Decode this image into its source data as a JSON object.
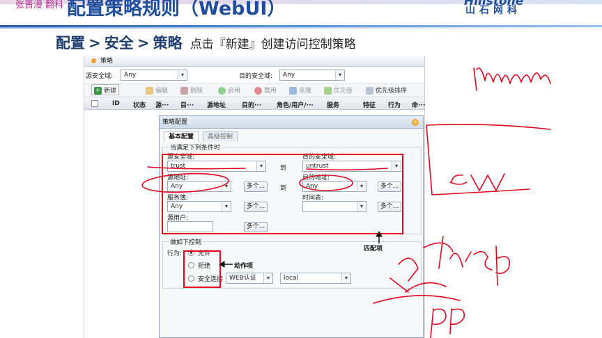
{
  "slide": {
    "title": "配置策略规则（WebUI）",
    "corner_tag": "张晋漫 翻科",
    "logo_en": "Hillstone",
    "logo_cn": "山石网科",
    "breadcrumb": {
      "part1": "配置",
      "sep1": ">",
      "part2": "安全",
      "sep2": ">",
      "part3": "策略",
      "instruction": "点击『新建』创建访问控制策略"
    }
  },
  "panel": {
    "title": "策略",
    "filter": {
      "src_zone_label": "源安全域:",
      "src_zone_value": "Any",
      "dst_zone_label": "目的安全域:",
      "dst_zone_value": "Any"
    },
    "toolbar": {
      "new": "新建",
      "edit": "编辑",
      "delete": "删除",
      "enable": "启用",
      "disable": "禁用",
      "clone": "克隆",
      "priority": "优先级",
      "priority_sort": "优先级排序"
    },
    "columns": [
      "ID",
      "状态",
      "源···",
      "目···",
      "源地址",
      "目的···",
      "角色/用户/···",
      "服务",
      "特征",
      "行为",
      "命···"
    ]
  },
  "dialog": {
    "title": "策略配置",
    "tabs": {
      "basic": "基本配置",
      "advanced": "高级控制"
    },
    "match": {
      "legend": "当满足下列条件时",
      "src_zone_label": "源安全域:",
      "src_zone_value": "trust",
      "to1": "到",
      "dst_zone_label": "目的安全域:",
      "dst_zone_value": "untrust",
      "src_addr_label": "源地址:",
      "src_addr_value": "Any",
      "more1": "多个...",
      "to2": "到",
      "dst_addr_label": "目的地址:",
      "dst_addr_value": "Any",
      "more2": "多个...",
      "service_label": "服务簿:",
      "service_value": "Any",
      "more3": "多个...",
      "schedule_label": "时间表:",
      "schedule_value": "",
      "more4": "多个...",
      "src_user_label": "源用户:",
      "src_user_value": "",
      "more5": "多个..."
    },
    "action": {
      "legend": "做如下控制",
      "label": "行为:",
      "permit": "允许",
      "deny": "拒绝",
      "secure": "安全连接",
      "webauth_value": "WEB认证",
      "local_value": "local"
    }
  },
  "annotations": {
    "match_items": "匹配项",
    "action_items": "动作项"
  },
  "colors": {
    "title_blue": "#1f4e9c",
    "highlight_red": "#e8001c",
    "hand_red": "#e1051e"
  }
}
